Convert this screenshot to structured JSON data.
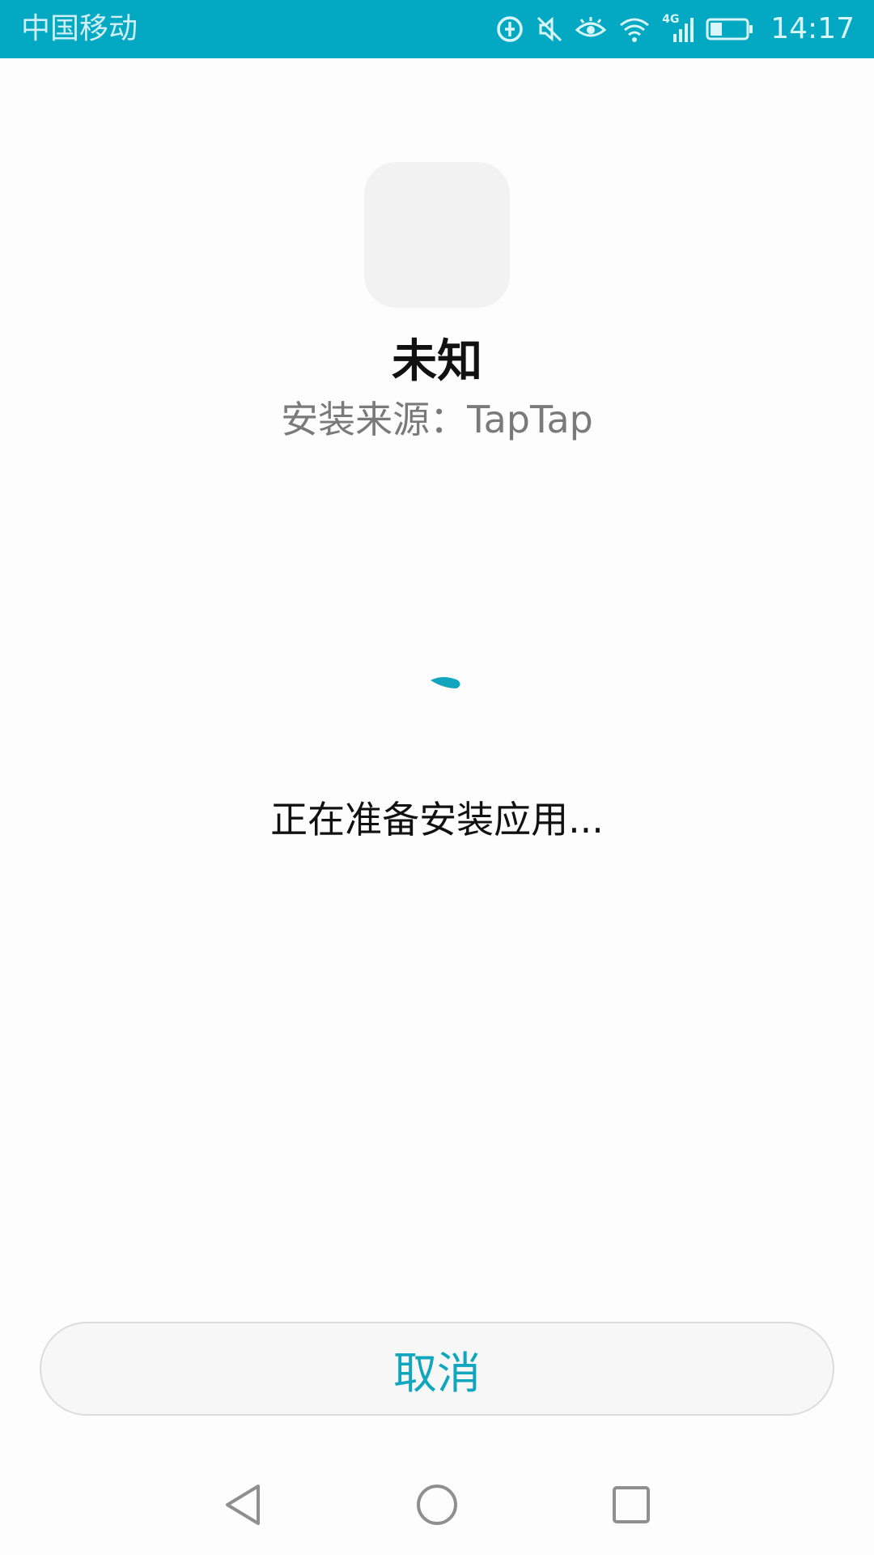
{
  "status_bar": {
    "carrier": "中国移动",
    "network_label": "4G",
    "time": "14:17",
    "icons": [
      "data-saver-icon",
      "mute-icon",
      "eye-comfort-icon",
      "wifi-icon",
      "signal-icon",
      "battery-icon"
    ],
    "background_color": "#03a9c3"
  },
  "app": {
    "name": "未知",
    "source": "安装来源：TapTap"
  },
  "progress": {
    "message": "正在准备安装应用..."
  },
  "actions": {
    "cancel_label": "取消",
    "accent_color": "#10a6bd"
  },
  "nav_bar": {
    "icons": [
      "back-icon",
      "home-icon",
      "recent-apps-icon"
    ]
  }
}
